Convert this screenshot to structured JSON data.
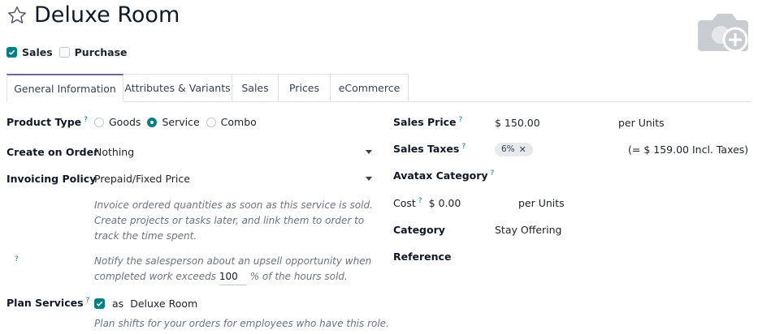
{
  "header": {
    "title": "Deluxe Room",
    "sales_label": "Sales",
    "purchase_label": "Purchase"
  },
  "tabs": [
    {
      "label": "General Information"
    },
    {
      "label": "Attributes & Variants"
    },
    {
      "label": "Sales"
    },
    {
      "label": "Prices"
    },
    {
      "label": "eCommerce"
    }
  ],
  "left": {
    "product_type_label": "Product Type",
    "q": "?",
    "goods": "Goods",
    "service": "Service",
    "combo": "Combo",
    "create_on_order_label": "Create on Order",
    "create_on_order_value": "Nothing",
    "invoicing_policy_label": "Invoicing Policy",
    "invoicing_policy_value": "Prepaid/Fixed Price",
    "invoice_help": "Invoice ordered quantities as soon as this service is sold. Create projects or tasks later, and link them to order to track the time spent.",
    "upsell_help_pre": "Notify the salesperson about an upsell opportunity when completed work exceeds",
    "upsell_value": "100",
    "upsell_help_post": "% of the hours sold.",
    "plan_services_label": "Plan Services",
    "plan_as": "as",
    "plan_role": "Deluxe Room",
    "plan_help": "Plan shifts for your orders for employees who have this role."
  },
  "right": {
    "sales_price_label": "Sales Price",
    "sales_price_value": "$ 150.00",
    "per_units": "per  Units",
    "sales_taxes_label": "Sales Taxes",
    "tax_badge": "6%",
    "incl_taxes": "(= $ 159.00 Incl. Taxes)",
    "avatax_label": "Avatax Category",
    "cost_label": "Cost",
    "cost_value": "$ 0.00",
    "cost_per_units": "per  Units",
    "category_label": "Category",
    "category_value": "Stay Offering",
    "reference_label": "Reference"
  },
  "colors": {
    "accent": "#017e84",
    "tab_active": "#71639e"
  },
  "icons": [
    "star-icon",
    "camera-add-icon",
    "check-icon",
    "caret-down-icon",
    "remove-x-icon"
  ]
}
